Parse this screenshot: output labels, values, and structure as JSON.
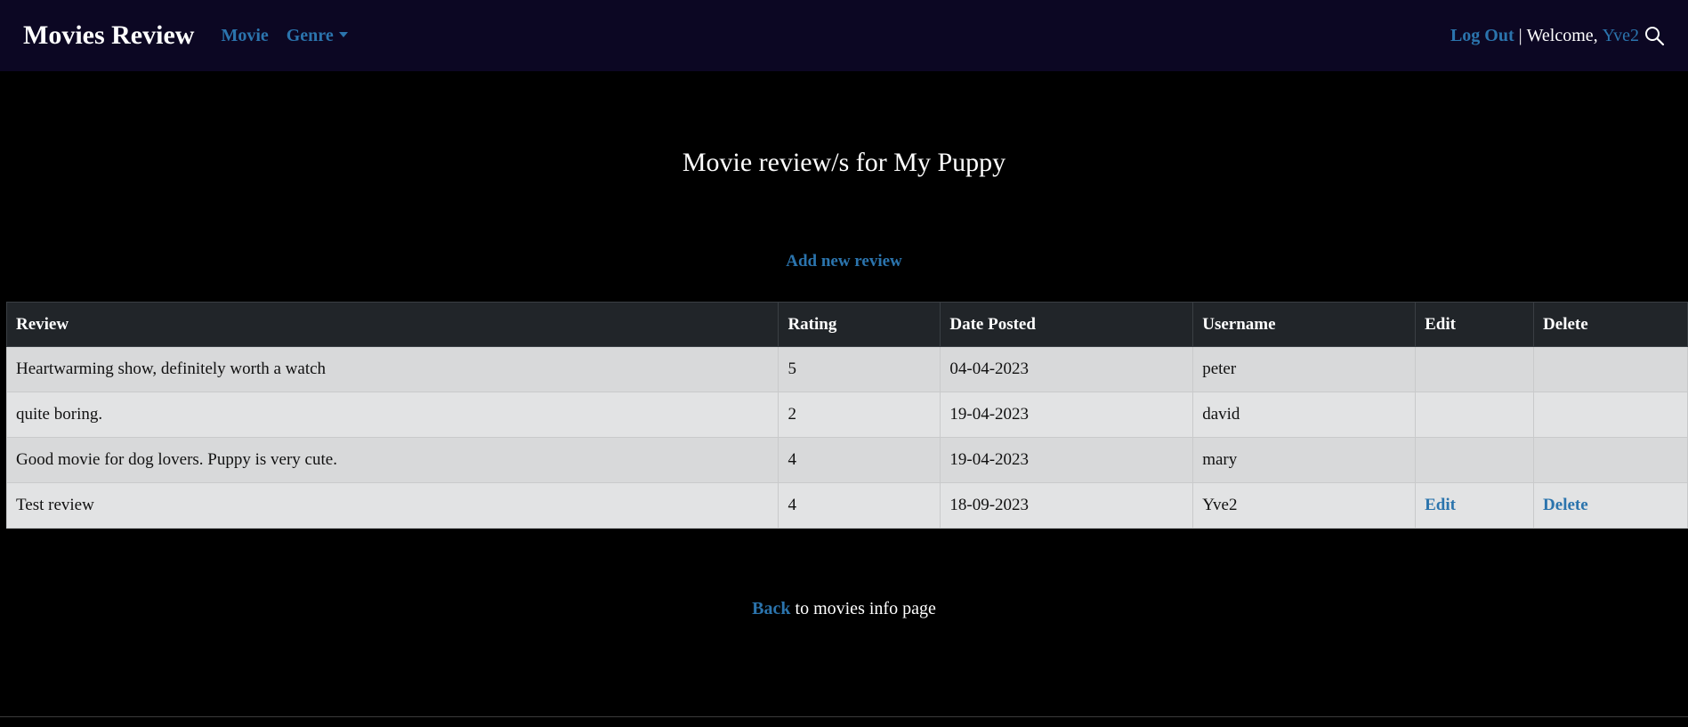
{
  "navbar": {
    "brand": "Movies Review",
    "links": {
      "movie": "Movie",
      "genre": "Genre"
    },
    "logout": "Log Out",
    "separator": " | ",
    "welcome": "Welcome, ",
    "username": "Yve2",
    "search_icon": "search-icon"
  },
  "main": {
    "title": "Movie review/s for My Puppy",
    "add_review": "Add new review",
    "table": {
      "headers": {
        "review": "Review",
        "rating": "Rating",
        "date": "Date Posted",
        "username": "Username",
        "edit": "Edit",
        "delete": "Delete"
      },
      "rows": [
        {
          "review": "Heartwarming show, definitely worth a watch",
          "rating": "5",
          "date": "04-04-2023",
          "username": "peter",
          "edit": "",
          "delete": ""
        },
        {
          "review": "quite boring.",
          "rating": "2",
          "date": "19-04-2023",
          "username": "david",
          "edit": "",
          "delete": ""
        },
        {
          "review": "Good movie for dog lovers. Puppy is very cute.",
          "rating": "4",
          "date": "19-04-2023",
          "username": "mary",
          "edit": "",
          "delete": ""
        },
        {
          "review": "Test review",
          "rating": "4",
          "date": "18-09-2023",
          "username": "Yve2",
          "edit": "Edit",
          "delete": "Delete"
        }
      ]
    },
    "back": {
      "link": "Back",
      "text": " to movies info page"
    }
  },
  "colors": {
    "navbar_bg": "#0c0723",
    "link": "#2b74ad",
    "page_bg": "#000000",
    "table_header_bg": "#212529",
    "row_odd": "#d8d9da",
    "row_even": "#e2e3e4"
  }
}
